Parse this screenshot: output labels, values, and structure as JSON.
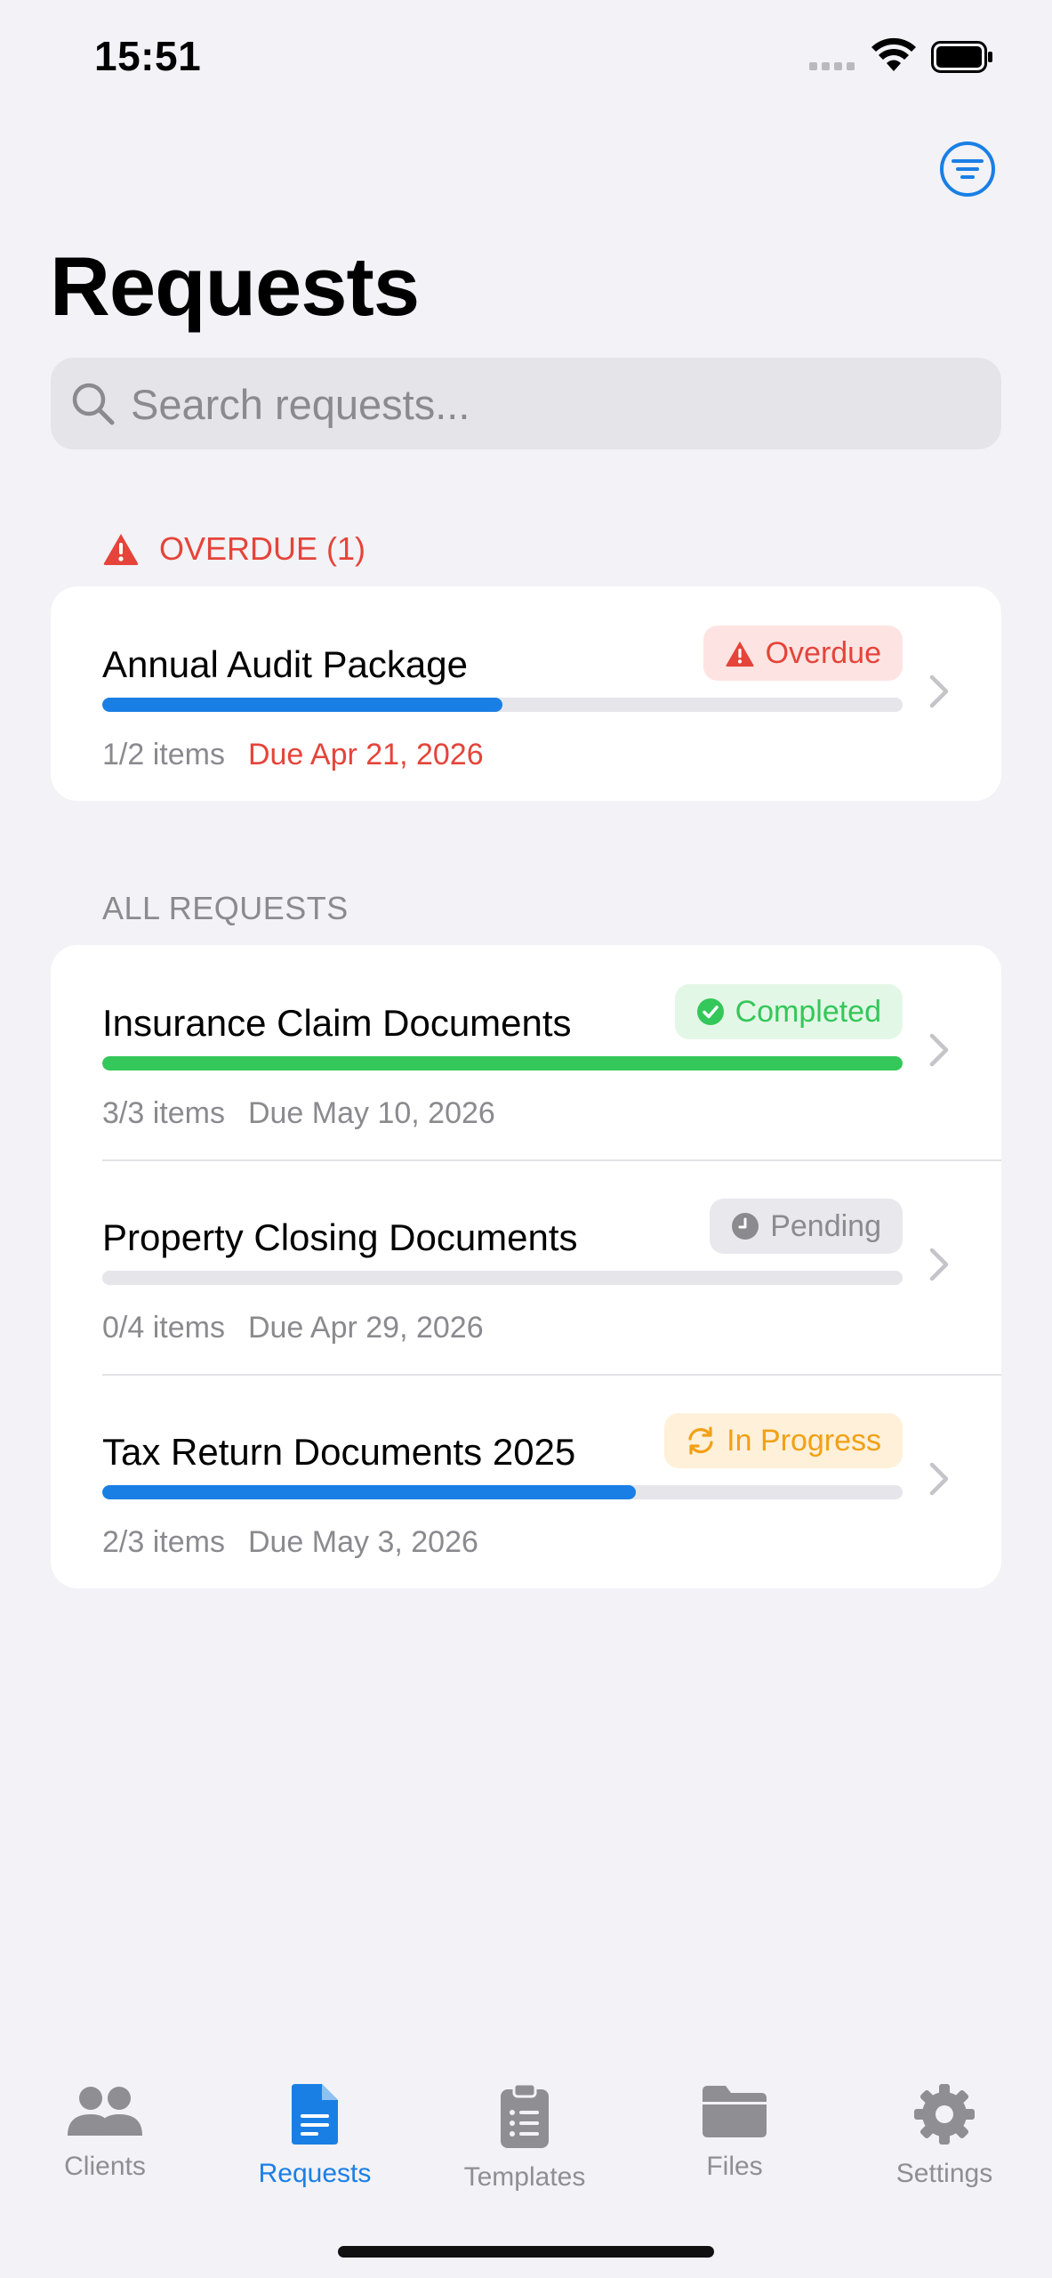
{
  "status_bar": {
    "time": "15:51"
  },
  "header": {
    "title": "Requests"
  },
  "search": {
    "placeholder": "Search requests..."
  },
  "sections": {
    "overdue_label": "OVERDUE (1)",
    "all_label": "ALL REQUESTS"
  },
  "overdue_requests": [
    {
      "title": "Annual Audit Package",
      "status": "Overdue",
      "items": "1/2 items",
      "due": "Due Apr 21, 2026",
      "progress": 0.5
    }
  ],
  "all_requests": [
    {
      "title": "Insurance Claim Documents",
      "status": "Completed",
      "items": "3/3 items",
      "due": "Due May 10, 2026",
      "progress": 1.0
    },
    {
      "title": "Property Closing Documents",
      "status": "Pending",
      "items": "0/4 items",
      "due": "Due Apr 29, 2026",
      "progress": 0.0
    },
    {
      "title": "Tax Return Documents 2025",
      "status": "In Progress",
      "items": "2/3 items",
      "due": "Due May 3, 2026",
      "progress": 0.667
    }
  ],
  "tabs": [
    {
      "label": "Clients",
      "icon": "people-icon"
    },
    {
      "label": "Requests",
      "icon": "document-icon",
      "active": true
    },
    {
      "label": "Templates",
      "icon": "clipboard-icon"
    },
    {
      "label": "Files",
      "icon": "folder-icon"
    },
    {
      "label": "Settings",
      "icon": "gear-icon"
    }
  ],
  "colors": {
    "accent": "#1a7fe5",
    "progress_blue": "#1a7fe5",
    "progress_green": "#34c759",
    "overdue_red": "#e5443a",
    "overdue_bg": "#fde4e2",
    "completed_green": "#34c759",
    "completed_bg": "#e3f7e7",
    "pending_gray": "#8a8a8f",
    "pending_bg": "#e8e8ed",
    "in_progress_orange": "#f2a014",
    "in_progress_bg": "#fff0d9"
  }
}
